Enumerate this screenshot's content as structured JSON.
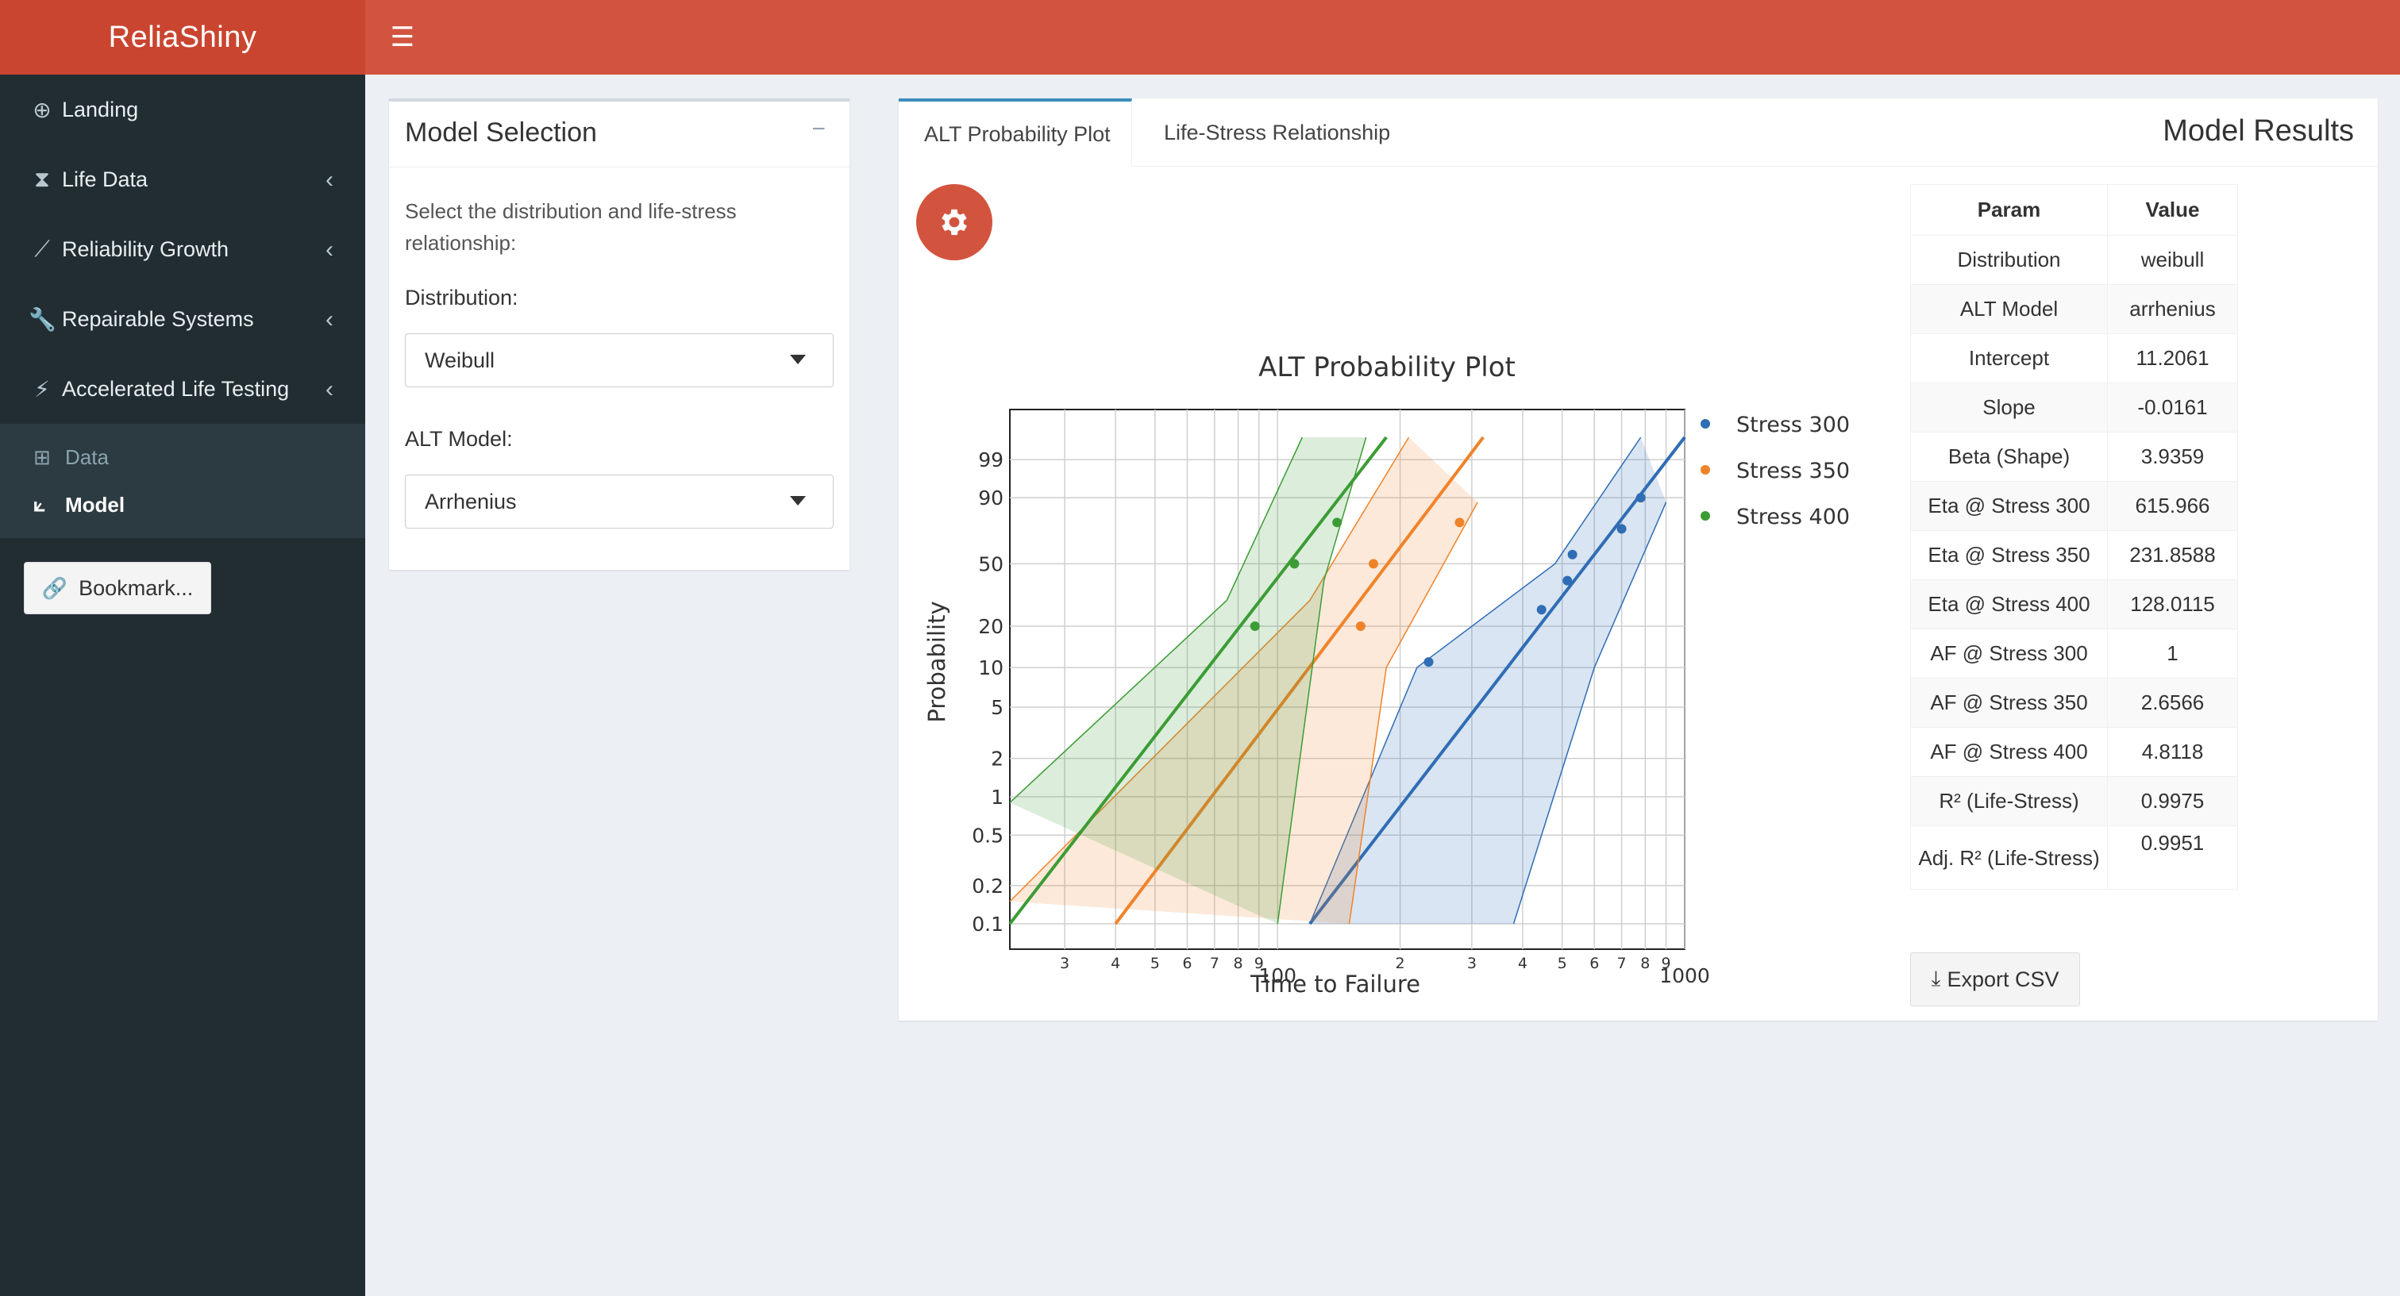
{
  "header": {
    "app_title": "ReliaShiny",
    "menu_icon": "hamburger-icon"
  },
  "sidebar": {
    "items": [
      {
        "label": "Landing",
        "icon": "hub-icon"
      },
      {
        "label": "Life Data",
        "icon": "hourglass-icon"
      },
      {
        "label": "Reliability Growth",
        "icon": "growth-icon"
      },
      {
        "label": "Repairable Systems",
        "icon": "wrench-icon"
      },
      {
        "label": "Accelerated Life Testing",
        "icon": "bolt-icon"
      }
    ],
    "subitems": [
      {
        "label": "Data",
        "icon": "table-icon"
      },
      {
        "label": "Model",
        "icon": "line-chart-icon"
      }
    ],
    "bookmark_label": "Bookmark..."
  },
  "model_selection": {
    "title": "Model Selection",
    "help_text": "Select the distribution and life-stress relationship:",
    "distribution_label": "Distribution:",
    "distribution_value": "Weibull",
    "alt_model_label": "ALT Model:",
    "alt_model_value": "Arrhenius"
  },
  "results": {
    "tabs": [
      "ALT Probability Plot",
      "Life-Stress Relationship"
    ],
    "title": "Model Results",
    "table_headers": [
      "Param",
      "Value"
    ],
    "table_rows": [
      [
        "Distribution",
        "weibull"
      ],
      [
        "ALT Model",
        "arrhenius"
      ],
      [
        "Intercept",
        "11.2061"
      ],
      [
        "Slope",
        "-0.0161"
      ],
      [
        "Beta (Shape)",
        "3.9359"
      ],
      [
        "Eta @ Stress 300",
        "615.966"
      ],
      [
        "Eta @ Stress 350",
        "231.8588"
      ],
      [
        "Eta @ Stress 400",
        "128.0115"
      ],
      [
        "AF @ Stress 300",
        "1"
      ],
      [
        "AF @ Stress 350",
        "2.6566"
      ],
      [
        "AF @ Stress 400",
        "4.8118"
      ],
      [
        "R² (Life-Stress)",
        "0.9975"
      ],
      [
        "Adj. R² (Life-Stress)",
        "0.9951"
      ]
    ],
    "export_label": "Export CSV"
  },
  "colors": {
    "header": "#d2543f",
    "logo": "#c9452f",
    "sidebar": "#222d32",
    "stress300": "#2f6db5",
    "stress350": "#f0832a",
    "stress400": "#3c9c35"
  },
  "chart_data": {
    "type": "scatter",
    "title": "ALT Probability Plot",
    "xlabel": "Time to Failure",
    "ylabel": "Probability",
    "x_scale": "log",
    "y_scale": "weibull",
    "xlim": [
      22,
      1000
    ],
    "x_major_ticks": [
      "100",
      "1000"
    ],
    "x_minor_ticks": [
      {
        "value": 30,
        "label": "3"
      },
      {
        "value": 40,
        "label": "4"
      },
      {
        "value": 50,
        "label": "5"
      },
      {
        "value": 60,
        "label": "6"
      },
      {
        "value": 70,
        "label": "7"
      },
      {
        "value": 80,
        "label": "8"
      },
      {
        "value": 90,
        "label": "9"
      },
      {
        "value": 200,
        "label": "2"
      },
      {
        "value": 300,
        "label": "3"
      },
      {
        "value": 400,
        "label": "4"
      },
      {
        "value": 500,
        "label": "5"
      },
      {
        "value": 600,
        "label": "6"
      },
      {
        "value": 700,
        "label": "7"
      },
      {
        "value": 800,
        "label": "8"
      },
      {
        "value": 900,
        "label": "9"
      }
    ],
    "y_ticks": [
      0.1,
      0.2,
      0.5,
      1,
      2,
      5,
      10,
      20,
      50,
      90,
      99
    ],
    "legend_position": "right",
    "series": [
      {
        "name": "Stress 300",
        "color": "#2f6db5",
        "points": [
          [
            235,
            11
          ],
          [
            445,
            26
          ],
          [
            515,
            40
          ],
          [
            530,
            56
          ],
          [
            700,
            73
          ],
          [
            780,
            90
          ]
        ],
        "fit": [
          [
            120,
            0.1
          ],
          [
            1000,
            99.9
          ]
        ],
        "band_lower": [
          [
            380,
            0.1
          ],
          [
            600,
            10
          ],
          [
            900,
            88
          ]
        ],
        "band_upper": [
          [
            120,
            0.1
          ],
          [
            220,
            10
          ],
          [
            480,
            50
          ],
          [
            780,
            99.9
          ]
        ]
      },
      {
        "name": "Stress 350",
        "color": "#f0832a",
        "points": [
          [
            160,
            20
          ],
          [
            172,
            50
          ],
          [
            280,
            77
          ]
        ],
        "fit": [
          [
            40,
            0.1
          ],
          [
            320,
            99.9
          ]
        ],
        "band_lower": [
          [
            150,
            0.1
          ],
          [
            185,
            10
          ],
          [
            310,
            88
          ]
        ],
        "band_upper": [
          [
            22,
            0.15
          ],
          [
            120,
            30
          ],
          [
            210,
            99.9
          ]
        ]
      },
      {
        "name": "Stress 400",
        "color": "#3c9c35",
        "points": [
          [
            88,
            20
          ],
          [
            110,
            50
          ],
          [
            140,
            77
          ]
        ],
        "fit": [
          [
            22,
            0.1
          ],
          [
            185,
            99.9
          ]
        ],
        "band_lower": [
          [
            100,
            0.1
          ],
          [
            130,
            40
          ],
          [
            165,
            99.9
          ]
        ],
        "band_upper": [
          [
            22,
            0.9
          ],
          [
            75,
            30
          ],
          [
            115,
            99.9
          ]
        ]
      }
    ]
  }
}
